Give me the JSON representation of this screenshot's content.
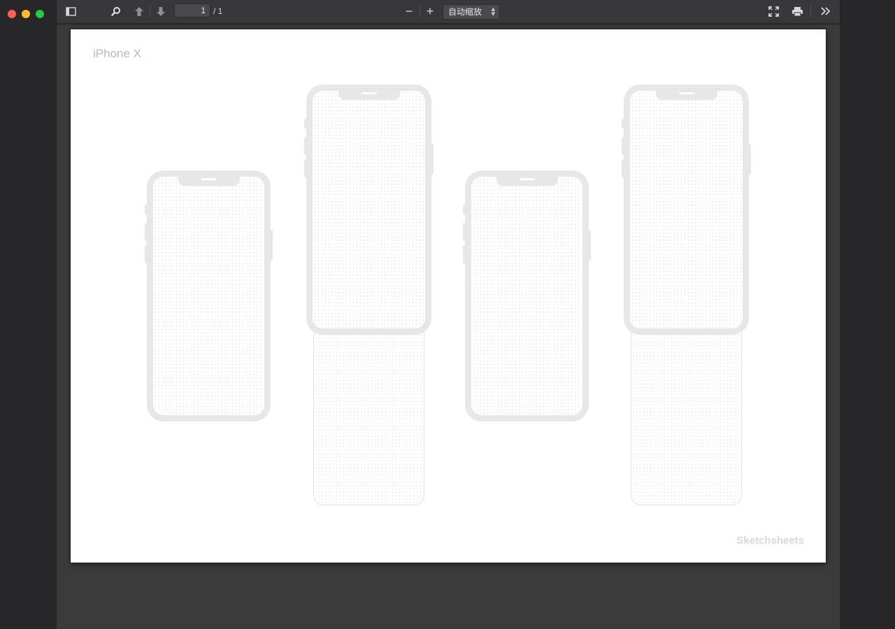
{
  "window": {
    "controls": {
      "close_color": "#ff5f57",
      "minimize_color": "#febc2e",
      "zoom_color": "#28c840"
    }
  },
  "toolbar": {
    "sidebar_toggle_icon": "sidebar-icon",
    "find_icon": "search-icon",
    "previous_icon": "arrow-up-icon",
    "next_icon": "arrow-down-icon",
    "page_number": "1",
    "page_total": "/ 1",
    "zoom_out_label": "−",
    "zoom_in_label": "+",
    "zoom_value": "自动缩放",
    "presentation_icon": "fullscreen-icon",
    "print_icon": "print-icon",
    "tools_icon": "double-chevron-right-icon"
  },
  "document": {
    "title": "iPhone X",
    "brand": "Sketchsheets",
    "device_outline_color": "#e6e7e8"
  }
}
